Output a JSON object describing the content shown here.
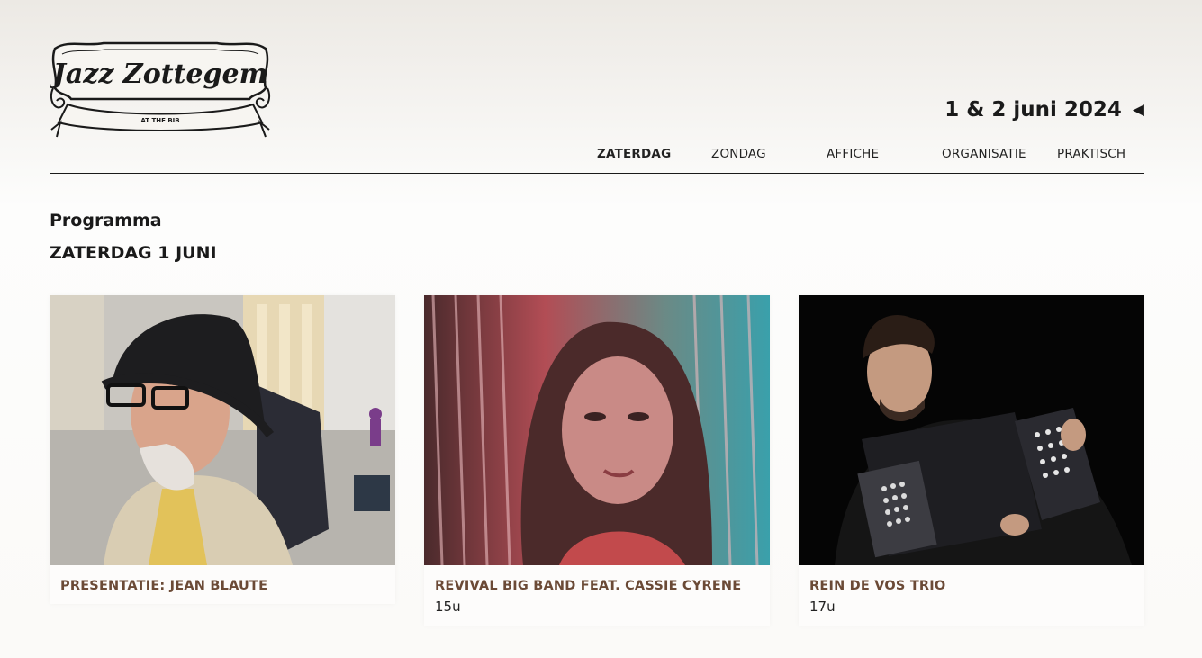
{
  "header": {
    "logo_text": "Jazz Zottegem",
    "logo_subtext": "AT THE BIB",
    "event_date": "1 & 2 juni 2024",
    "date_arrow_icon": "triangle-left-icon"
  },
  "nav": {
    "items": [
      {
        "label": "ZATERDAG",
        "active": true
      },
      {
        "label": "ZONDAG",
        "active": false
      },
      {
        "label": "AFFICHE",
        "active": false
      },
      {
        "label": "ORGANISATIE",
        "active": false
      },
      {
        "label": "PRAKTISCH",
        "active": false
      }
    ]
  },
  "main": {
    "section_title": "Programma",
    "day_title": "ZATERDAG 1 JUNI",
    "cards": [
      {
        "title": "PRESENTATIE: JEAN BLAUTE",
        "time": "",
        "photo": "man-with-black-hat-photo"
      },
      {
        "title": "REVIVAL BIG BAND FEAT. CASSIE CYRENE",
        "time": "15u",
        "photo": "singer-in-pink-light-photo"
      },
      {
        "title": "REIN DE VOS TRIO",
        "time": "17u",
        "photo": "accordion-player-photo"
      }
    ]
  },
  "colors": {
    "act_title": "#6b4a36",
    "text": "#1a1a1a",
    "divider": "#1a1a1a"
  }
}
